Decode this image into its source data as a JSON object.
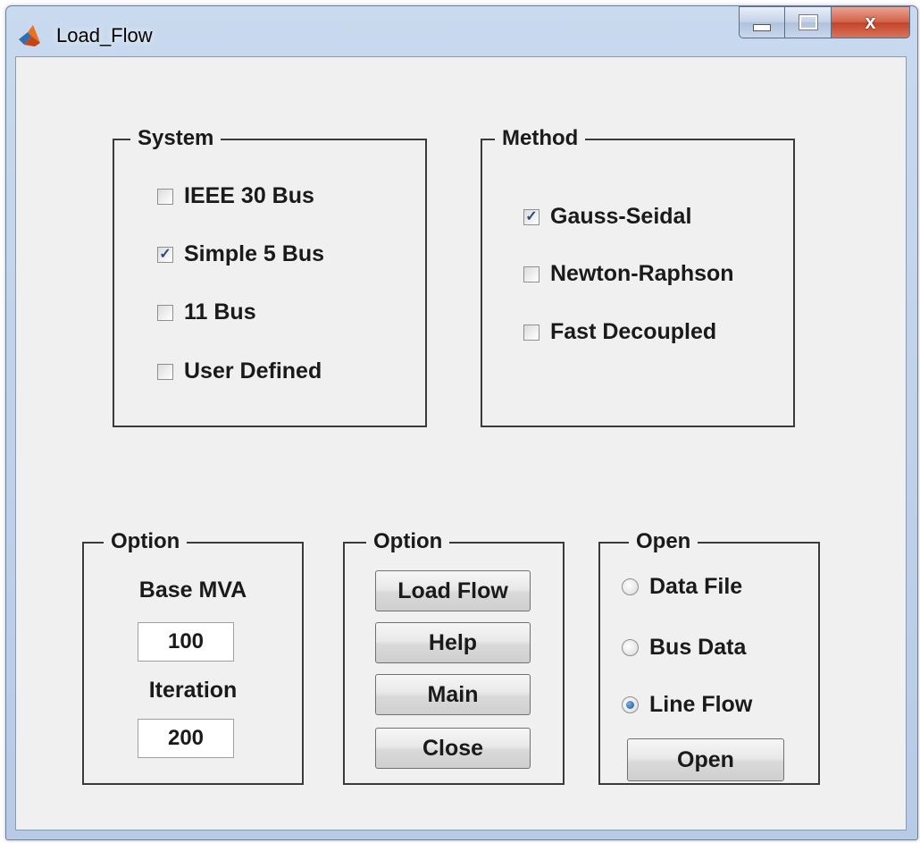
{
  "window": {
    "title": "Load_Flow",
    "icon": "matlab-icon"
  },
  "caption_buttons": {
    "close_label": "x"
  },
  "system_panel": {
    "title": "System",
    "options": [
      {
        "label": "IEEE 30 Bus",
        "checked": false
      },
      {
        "label": "Simple 5 Bus",
        "checked": true
      },
      {
        "label": "11 Bus",
        "checked": false
      },
      {
        "label": "User Defined",
        "checked": false
      }
    ]
  },
  "method_panel": {
    "title": "Method",
    "options": [
      {
        "label": "Gauss-Seidal",
        "checked": true
      },
      {
        "label": "Newton-Raphson",
        "checked": false
      },
      {
        "label": "Fast Decoupled",
        "checked": false
      }
    ]
  },
  "option_panel_params": {
    "title": "Option",
    "base_mva_label": "Base MVA",
    "base_mva_value": "100",
    "iteration_label": "Iteration",
    "iteration_value": "200"
  },
  "option_panel_actions": {
    "title": "Option",
    "buttons": [
      "Load Flow",
      "Help",
      "Main",
      "Close"
    ]
  },
  "open_panel": {
    "title": "Open",
    "options": [
      {
        "label": "Data File",
        "selected": false
      },
      {
        "label": "Bus Data",
        "selected": false
      },
      {
        "label": "Line Flow",
        "selected": true
      }
    ],
    "open_button": "Open"
  },
  "check_glyph": "✓"
}
